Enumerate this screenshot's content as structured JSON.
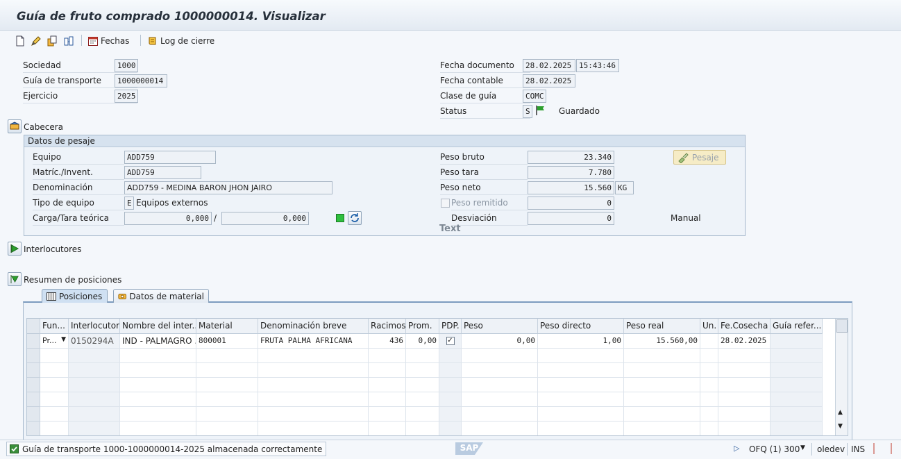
{
  "window": {
    "title": "Guía de fruto comprado 1000000014. Visualizar"
  },
  "toolbar": {
    "icons": [
      "new-document-icon",
      "edit-icon",
      "copy-icon",
      "display-icon"
    ],
    "fechas_label": "Fechas",
    "log_label": "Log de cierre"
  },
  "header": {
    "sociedad_label": "Sociedad",
    "sociedad_value": "1000",
    "guia_label": "Guía de transporte",
    "guia_value": "1000000014",
    "ejercicio_label": "Ejercicio",
    "ejercicio_value": "2025",
    "fecha_doc_label": "Fecha documento",
    "fecha_doc_value": "28.02.2025",
    "hora_doc_value": "15:43:46",
    "fecha_cont_label": "Fecha contable",
    "fecha_cont_value": "28.02.2025",
    "clase_label": "Clase de guía",
    "clase_value": "COMC",
    "status_label": "Status",
    "status_value": "S",
    "status_text": "Guardado"
  },
  "sections": {
    "cabecera": "Cabecera",
    "interlocutores": "Interlocutores",
    "resumen": "Resumen de posiciones"
  },
  "pesaje": {
    "group_title": "Datos de pesaje",
    "equipo_label": "Equipo",
    "equipo_value": "ADD759",
    "matric_label": "Matríc./Invent.",
    "matric_value": "ADD759",
    "denom_label": "Denominación",
    "denom_value": "ADD759 - MEDINA BARON JHON JAIRO",
    "tipo_label": "Tipo de equipo",
    "tipo_code": "E",
    "tipo_text": "Equipos externos",
    "carga_label": "Carga/Tara teórica",
    "carga_value": "0,000",
    "separator": "/",
    "tara_value": "0,000",
    "bruto_label": "Peso bruto",
    "bruto_value": "23.340",
    "tara_label": "Peso tara",
    "tara_peso_value": "7.780",
    "neto_label": "Peso neto",
    "neto_value": "15.560",
    "neto_unit": "KG",
    "remitido_label": "Peso remitido",
    "remitido_value": "0",
    "desviacion_label": "Desviación",
    "desviacion_value": "0",
    "text_label": "Text",
    "manual_label": "Manual",
    "pesaje_button": "Pesaje"
  },
  "tabs": [
    {
      "label": "Posiciones"
    },
    {
      "label": "Datos de material"
    }
  ],
  "table": {
    "columns": [
      "Fun...",
      "Interlocutor",
      "Nombre del inter...",
      "Material",
      "Denominación breve",
      "Racimos",
      "Prom.",
      "PDP.",
      "Peso",
      "Peso directo",
      "Peso real",
      "Un.",
      "Fe.Cosecha",
      "Guía refer..."
    ],
    "rows": [
      {
        "fun": "Pr...",
        "interlocutor": "0150294A",
        "nombre": "IND - PALMAGRO ...",
        "material": "800001",
        "denominacion": "FRUTA PALMA AFRICANA",
        "racimos": "436",
        "prom": "0,00",
        "pdp": true,
        "peso": "0,00",
        "peso_directo": "1,00",
        "peso_real": "15.560,00",
        "un": "",
        "fe_cosecha": "28.02.2025",
        "guia_ref": ""
      }
    ]
  },
  "status_bar": {
    "message": "Guía de transporte 1000-1000000014-2025 almacenada correctamente",
    "logo": "SAP",
    "system": "OFQ (1) 300",
    "server": "oledev",
    "mode": "INS"
  },
  "colors": {
    "title_bg": "#e3eaf2",
    "group_bg": "#eef3f9",
    "accent": "#7b9bbf",
    "status_green": "#2ea02e"
  }
}
